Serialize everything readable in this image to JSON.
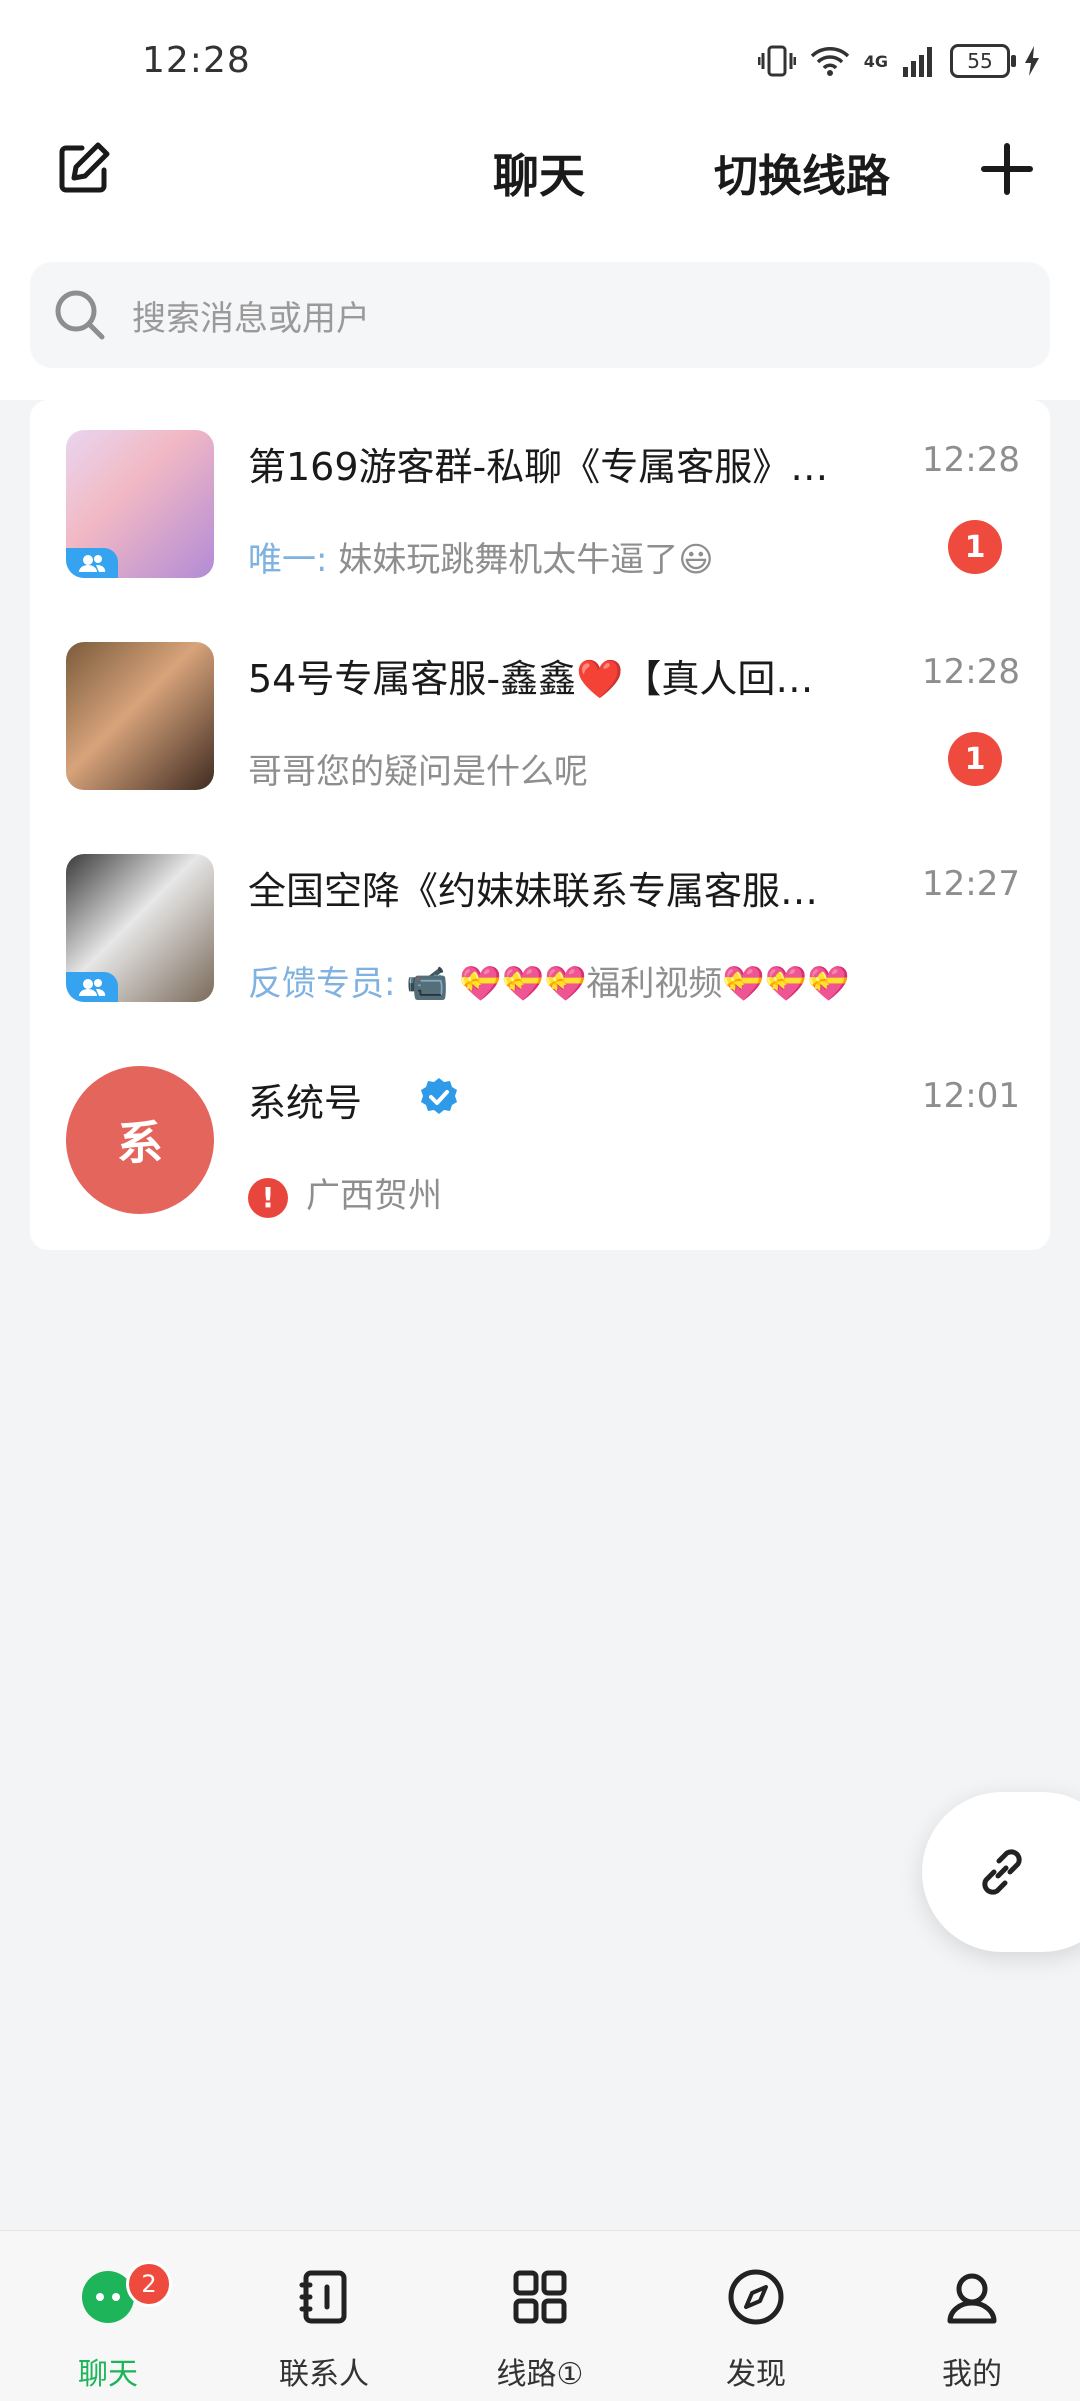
{
  "status_bar": {
    "time": "12:28",
    "network": "4G",
    "battery": "55"
  },
  "header": {
    "title": "聊天",
    "switch_route": "切换线路"
  },
  "search": {
    "placeholder": "搜索消息或用户"
  },
  "chats": [
    {
      "name": "第169游客群-私聊《专属客服》…",
      "time": "12:28",
      "sender": "唯一:",
      "preview": "妹妹玩跳舞机太牛逼了😃",
      "unread": "1",
      "avatar_type": "group-photo"
    },
    {
      "name": "54号专属客服-鑫鑫❤️【真人回…",
      "time": "12:28",
      "sender": "",
      "preview": "哥哥您的疑问是什么呢",
      "unread": "1",
      "avatar_type": "photo"
    },
    {
      "name": "全国空降《约妹妹联系专属客服…",
      "time": "12:27",
      "sender": "反馈专员:",
      "preview": "📹 💝💝💝福利视频💝💝💝",
      "unread": "",
      "avatar_type": "group-photo"
    },
    {
      "name": "系统号",
      "time": "12:01",
      "sender": "",
      "preview": "广西贺州",
      "unread": "",
      "avatar_type": "system",
      "avatar_text": "系",
      "verified": true,
      "alert": true
    }
  ],
  "bottom_nav": [
    {
      "label": "聊天",
      "icon": "chat-bubble-icon",
      "badge": "2",
      "active": true
    },
    {
      "label": "联系人",
      "icon": "contacts-icon"
    },
    {
      "label": "线路①",
      "icon": "grid-icon"
    },
    {
      "label": "发现",
      "icon": "compass-icon"
    },
    {
      "label": "我的",
      "icon": "person-icon"
    }
  ],
  "colors": {
    "accent_green": "#1db45a",
    "badge_red": "#ef4a3e",
    "sender_blue": "#7fb2e0",
    "system_avatar": "#e4655b"
  }
}
